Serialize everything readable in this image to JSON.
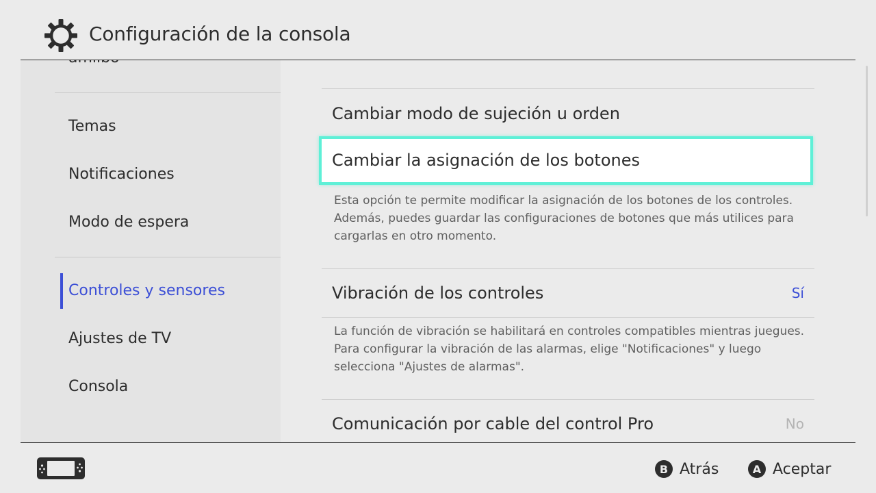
{
  "header": {
    "title": "Configuración de la consola",
    "icon": "gear-icon"
  },
  "sidebar": {
    "partial_item": "amiibo",
    "items": [
      {
        "label": "Temas"
      },
      {
        "label": "Notificaciones"
      },
      {
        "label": "Modo de espera"
      },
      {
        "label": "Controles y sensores",
        "active": true
      },
      {
        "label": "Ajustes de TV"
      },
      {
        "label": "Consola"
      }
    ]
  },
  "main": {
    "rows": [
      {
        "title": "Cambiar modo de sujeción u orden"
      },
      {
        "title": "Cambiar la asignación de los botones",
        "selected": true,
        "description": "Esta opción te permite modificar la asignación de los botones de los controles. Además, puedes guardar las configuraciones de botones que más utilices para cargarlas en otro momento."
      },
      {
        "title": "Vibración de los controles",
        "value": "Sí",
        "description": "La función de vibración se habilitará en controles compatibles mientras juegues. Para configurar la vibración de las alarmas, elige \"Notificaciones\" y luego selecciona \"Ajustes de alarmas\"."
      },
      {
        "title": "Comunicación por cable del control Pro",
        "value": "No"
      }
    ]
  },
  "footer": {
    "icon": "controller-icon",
    "back": {
      "key": "B",
      "label": "Atrás"
    },
    "accept": {
      "key": "A",
      "label": "Aceptar"
    }
  },
  "colors": {
    "background": "#ebebeb",
    "sidebar_bg": "#e4e4e4",
    "accent_blue": "#3c4fd6",
    "selection_cyan": "#5ef0d7",
    "disabled_value": "#b4b4b4"
  }
}
